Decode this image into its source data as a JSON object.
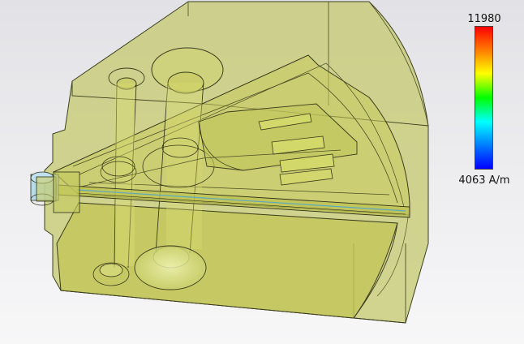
{
  "legend": {
    "max_value": "11980",
    "min_value": "4063 A/m",
    "colormap": [
      "#ff0000",
      "#ff8000",
      "#ffff00",
      "#00ff00",
      "#00ffff",
      "#0080ff",
      "#0000ff"
    ]
  },
  "model": {
    "body_color": "#c2c86a",
    "edge_color": "#3a3a1a",
    "port_color": "#9fd2e6"
  }
}
